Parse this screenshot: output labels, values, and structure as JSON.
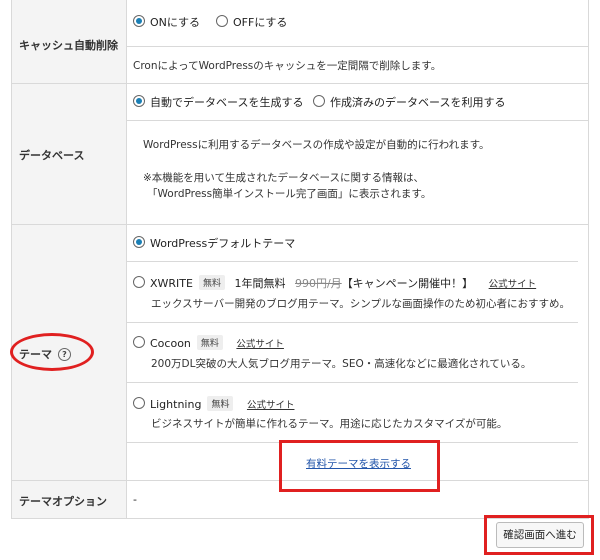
{
  "cache": {
    "label": "キャッシュ自動削除",
    "on_label": "ONにする",
    "off_label": "OFFにする",
    "description": "CronによってWordPressのキャッシュを一定間隔で削除します。"
  },
  "database": {
    "label": "データベース",
    "auto_label": "自動でデータベースを生成する",
    "existing_label": "作成済みのデータベースを利用する",
    "desc1": "WordPressに利用するデータベースの作成や設定が自動的に行われます。",
    "desc2": "※本機能を用いて生成されたデータベースに関する情報は、",
    "desc3": "「WordPress簡単インストール完了画面」に表示されます。"
  },
  "theme": {
    "label": "テーマ",
    "help_icon": "?",
    "default_label": "WordPressデフォルトテーマ",
    "xwrite": {
      "name": "XWRITE",
      "badge": "無料",
      "promo_prefix": "1年間無料",
      "old_price": "990円/月",
      "promo_suffix": "【キャンペーン開催中！】",
      "link": "公式サイト",
      "desc": "エックスサーバー開発のブログ用テーマ。シンプルな画面操作のため初心者におすすめ。"
    },
    "cocoon": {
      "name": "Cocoon",
      "badge": "無料",
      "link": "公式サイト",
      "desc": "200万DL突破の大人気ブログ用テーマ。SEO・高速化などに最適化されている。"
    },
    "lightning": {
      "name": "Lightning",
      "badge": "無料",
      "link": "公式サイト",
      "desc": "ビジネスサイトが簡単に作れるテーマ。用途に応じたカスタマイズが可能。"
    },
    "show_paid_link": "有料テーマを表示する"
  },
  "theme_option": {
    "label": "テーマオプション",
    "value": "-"
  },
  "confirm_button": "確認画面へ進む",
  "colors": {
    "accent": "#1a7fb5",
    "annotation_red": "#e02020",
    "link_blue": "#2255aa"
  }
}
